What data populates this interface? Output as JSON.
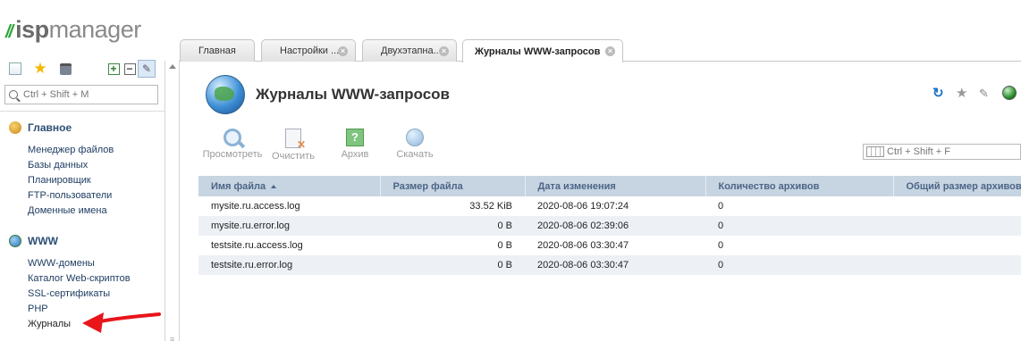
{
  "logo": {
    "isp": "isp",
    "manager": "manager"
  },
  "sidebar": {
    "search_placeholder": "Ctrl + Shift + M",
    "sections": [
      {
        "title": "Главное",
        "items": [
          "Менеджер файлов",
          "Базы данных",
          "Планировщик",
          "FTP-пользователи",
          "Доменные имена"
        ]
      },
      {
        "title": "WWW",
        "items": [
          "WWW-домены",
          "Каталог Web-скриптов",
          "SSL-сертификаты",
          "PHP",
          "Журналы"
        ]
      }
    ]
  },
  "tabs": [
    {
      "label": "Главная",
      "closable": false
    },
    {
      "label": "Настройки ...",
      "closable": true
    },
    {
      "label": "Двухэтапна...",
      "closable": true
    },
    {
      "label": "Журналы WWW-запросов",
      "closable": true,
      "active": true
    }
  ],
  "page": {
    "title": "Журналы WWW-запросов"
  },
  "toolbar": {
    "view": "Просмотреть",
    "clear": "Очистить",
    "archive": "Архив",
    "download": "Скачать",
    "arch_glyph": "?"
  },
  "grid": {
    "search_placeholder": "Ctrl + Shift + F",
    "columns": [
      "Имя файла",
      "Размер файла",
      "Дата изменения",
      "Количество архивов",
      "Общий размер архивов"
    ],
    "sorted_column": "Имя файла",
    "rows": [
      {
        "name": "mysite.ru.access.log",
        "size": "33.52 KiB",
        "modified": "2020-08-06 19:07:24",
        "archives": "0",
        "archives_size": ""
      },
      {
        "name": "mysite.ru.error.log",
        "size": "0 B",
        "modified": "2020-08-06 02:39:06",
        "archives": "0",
        "archives_size": ""
      },
      {
        "name": "testsite.ru.access.log",
        "size": "0 B",
        "modified": "2020-08-06 03:30:47",
        "archives": "0",
        "archives_size": ""
      },
      {
        "name": "testsite.ru.error.log",
        "size": "0 B",
        "modified": "2020-08-06 03:30:47",
        "archives": "0",
        "archives_size": ""
      }
    ]
  },
  "colors": {
    "brand_green": "#2ea43a",
    "nav_link": "#1f3d62",
    "table_header_bg": "#c7d4e2",
    "table_header_text": "#4b6585",
    "alt_row_bg": "#edf1f6",
    "arrow_red": "#e8151b"
  },
  "icons": {
    "sidebar_toolbar": [
      "tree-icon",
      "star-icon",
      "book-icon",
      "expand-all-icon",
      "collapse-all-icon",
      "pin-icon"
    ],
    "header": [
      "refresh-icon",
      "favorite-star-icon",
      "pin-icon",
      "globe-icon"
    ]
  }
}
